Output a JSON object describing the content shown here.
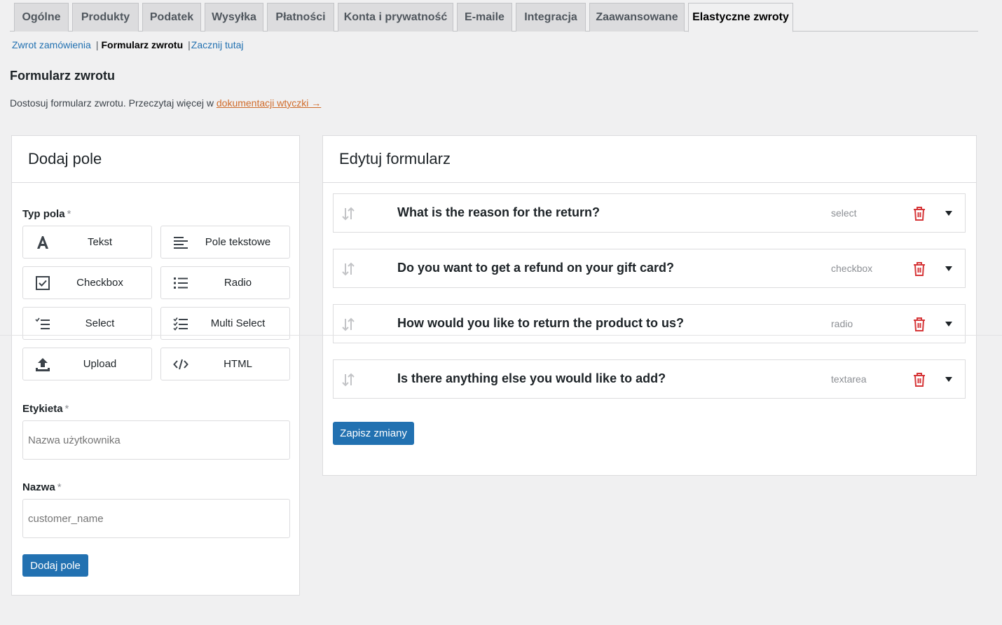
{
  "tabs": [
    {
      "label": "Ogólne"
    },
    {
      "label": "Produkty"
    },
    {
      "label": "Podatek"
    },
    {
      "label": "Wysyłka"
    },
    {
      "label": "Płatności"
    },
    {
      "label": "Konta i prywatność"
    },
    {
      "label": "E-maile"
    },
    {
      "label": "Integracja"
    },
    {
      "label": "Zaawansowane"
    },
    {
      "label": "Elastyczne zwroty",
      "active": true
    }
  ],
  "subnav": {
    "item1": "Zwrot zamówienia",
    "sep": "|",
    "item2": "Formularz zwrotu",
    "item3": "Zacznij tutaj"
  },
  "page": {
    "title": "Formularz zwrotu",
    "desc": "Dostosuj formularz zwrotu. Przeczytaj więcej w ",
    "desc_link": "dokumentacji wtyczki →"
  },
  "add_panel": {
    "title": "Dodaj pole",
    "type_label": "Typ pola",
    "required_mark": "*",
    "types": [
      {
        "label": "Tekst",
        "icon": "text-icon"
      },
      {
        "label": "Pole tekstowe",
        "icon": "textarea-icon"
      },
      {
        "label": "Checkbox",
        "icon": "checkbox-icon"
      },
      {
        "label": "Radio",
        "icon": "list-icon"
      },
      {
        "label": "Select",
        "icon": "select-icon"
      },
      {
        "label": "Multi Select",
        "icon": "multiselect-icon"
      },
      {
        "label": "Upload",
        "icon": "upload-icon"
      },
      {
        "label": "HTML",
        "icon": "code-icon"
      }
    ],
    "label_label": "Etykieta",
    "label_placeholder": "Nazwa użytkownika",
    "name_label": "Nazwa",
    "name_placeholder": "customer_name",
    "submit": "Dodaj pole"
  },
  "edit_panel": {
    "title": "Edytuj formularz",
    "rows": [
      {
        "question": "What is the reason for the return?",
        "type": "select"
      },
      {
        "question": "Do you want to get a refund on your gift card?",
        "type": "checkbox"
      },
      {
        "question": "How would you like to return the product to us?",
        "type": "radio"
      },
      {
        "question": "Is there anything else you would like to add?",
        "type": "textarea"
      }
    ],
    "save": "Zapisz zmiany"
  },
  "colors": {
    "accent": "#2271b1",
    "link_orange": "#d06b2a",
    "delete_red": "#d63638"
  }
}
